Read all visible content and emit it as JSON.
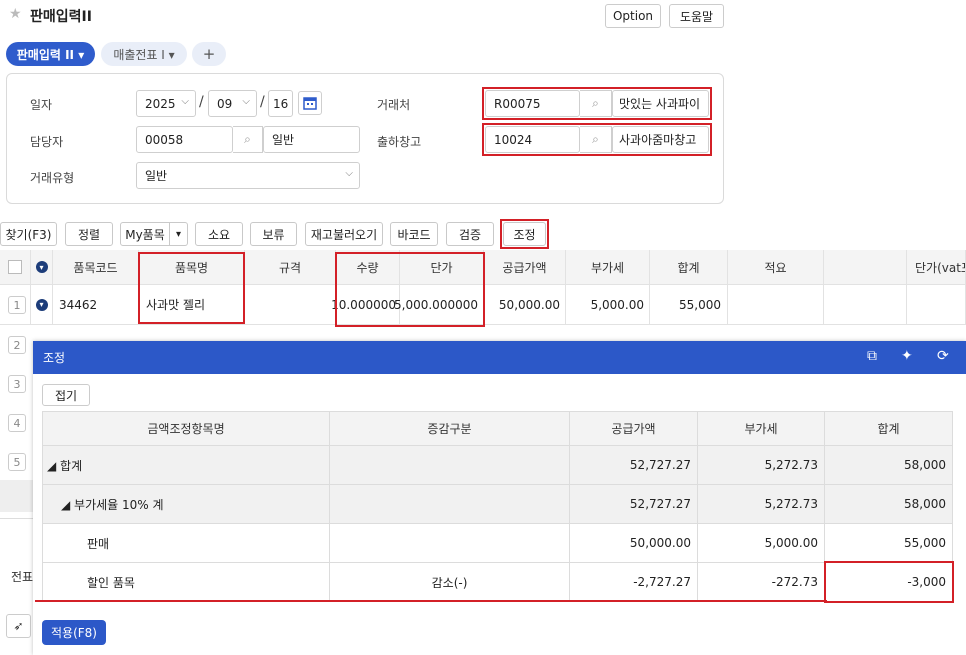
{
  "page": {
    "title": "판매입력II"
  },
  "header_buttons": {
    "option": "Option",
    "help": "도움말"
  },
  "tabs": [
    {
      "label": "판매입력 II ▾"
    },
    {
      "label": "매출전표 I ▾"
    },
    {
      "label": "+"
    }
  ],
  "form": {
    "date_label": "일자",
    "year": "2025",
    "month": "09",
    "day": "16",
    "manager_label": "담당자",
    "manager_code": "00058",
    "manager_name": "일반",
    "trade_type_label": "거래유형",
    "trade_type": "일반",
    "customer_label": "거래처",
    "customer_code": "R00075",
    "customer_name": "맛있는 사과파이",
    "warehouse_label": "출하창고",
    "warehouse_code": "10024",
    "warehouse_name": "사과아줌마창고"
  },
  "toolbar": [
    "찾기(F3)",
    "정렬",
    "My품목",
    "▾",
    "소요",
    "보류",
    "재고불러오기",
    "바코드",
    "검증",
    "조정"
  ],
  "grid": {
    "headers": [
      "품목코드",
      "품목명",
      "규격",
      "수량",
      "단가",
      "공급가액",
      "부가세",
      "합계",
      "적요",
      "",
      "단가(vat포"
    ],
    "row1": {
      "num": "1",
      "code": "34462",
      "name": "사과맛 젤리",
      "spec": "",
      "qty": "10.000000",
      "price": "5,000.000000",
      "supply": "50,000.00",
      "vat": "5,000.00",
      "total": "55,000",
      "memo": ""
    },
    "row_numbers": [
      "2",
      "3",
      "4",
      "5"
    ]
  },
  "left_peek": {
    "text": "전표"
  },
  "popup": {
    "title": "조정",
    "fold_label": "접기",
    "headers": [
      "금액조정항목명",
      "증감구분",
      "공급가액",
      "부가세",
      "합계"
    ],
    "rows": [
      {
        "name": "◢ 합계",
        "kind": "",
        "supply": "52,727.27",
        "vat": "5,272.73",
        "total": "58,000"
      },
      {
        "name": "◢ 부가세율 10% 계",
        "kind": "",
        "supply": "52,727.27",
        "vat": "5,272.73",
        "total": "58,000"
      },
      {
        "name": "판매",
        "kind": "",
        "supply": "50,000.00",
        "vat": "5,000.00",
        "total": "55,000"
      },
      {
        "name": "할인 품목",
        "kind": "감소(-)",
        "supply": "-2,727.27",
        "vat": "-272.73",
        "total": "-3,000"
      }
    ],
    "apply_label": "적용(F8)"
  },
  "colors": {
    "accent": "#2c58c8",
    "highlight": "#d32027"
  }
}
